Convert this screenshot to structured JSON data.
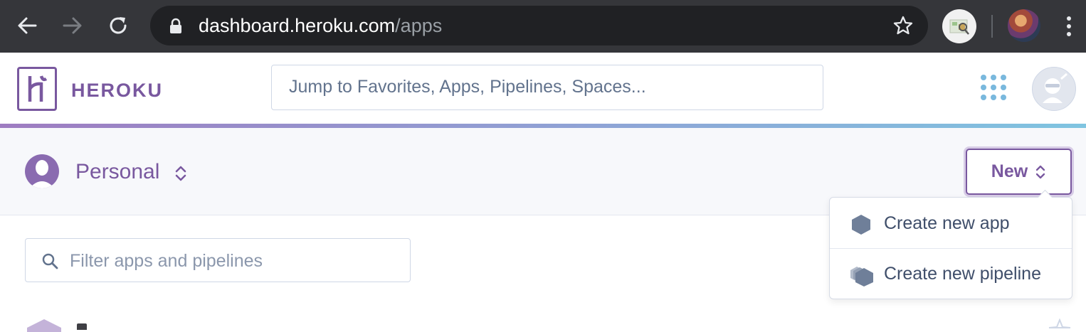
{
  "browser": {
    "url_host": "dashboard.heroku.com",
    "url_path": "/apps",
    "icons": {
      "back": "arrow-left-icon",
      "forward": "arrow-right-icon",
      "reload": "reload-icon",
      "lock": "lock-icon",
      "bookmark": "star-icon",
      "extension": "extension-icon",
      "profile": "profile-avatar",
      "menu": "kebab-menu-icon"
    }
  },
  "header": {
    "logo_text": "HEROKU",
    "search_placeholder": "Jump to Favorites, Apps, Pipelines, Spaces..."
  },
  "subheader": {
    "team_name": "Personal",
    "new_button_label": "New"
  },
  "main": {
    "filter_placeholder": "Filter apps and pipelines"
  },
  "dropdown": {
    "items": [
      {
        "label": "Create new app",
        "icon": "hexagon-icon"
      },
      {
        "label": "Create new pipeline",
        "icon": "stacked-hexagons-icon"
      }
    ]
  },
  "colors": {
    "brand_purple": "#79589f",
    "chrome_dark": "#35363a",
    "omnibox": "#202124",
    "grid_blue": "#79b8dd"
  }
}
